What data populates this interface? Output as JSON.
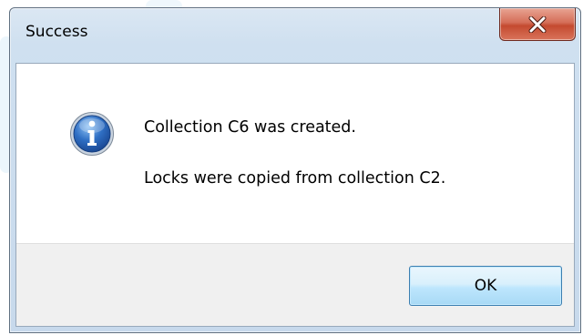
{
  "dialog": {
    "title": "Success",
    "close_icon": "close-x-icon",
    "icon": "information-icon",
    "message_lines": [
      "Collection C6 was created.",
      "Locks were copied from collection C2."
    ],
    "ok_label": "OK"
  },
  "colors": {
    "close_button": "#c7503a",
    "ok_button_border": "#3c7fb1",
    "info_icon": "#2f6fc4"
  }
}
